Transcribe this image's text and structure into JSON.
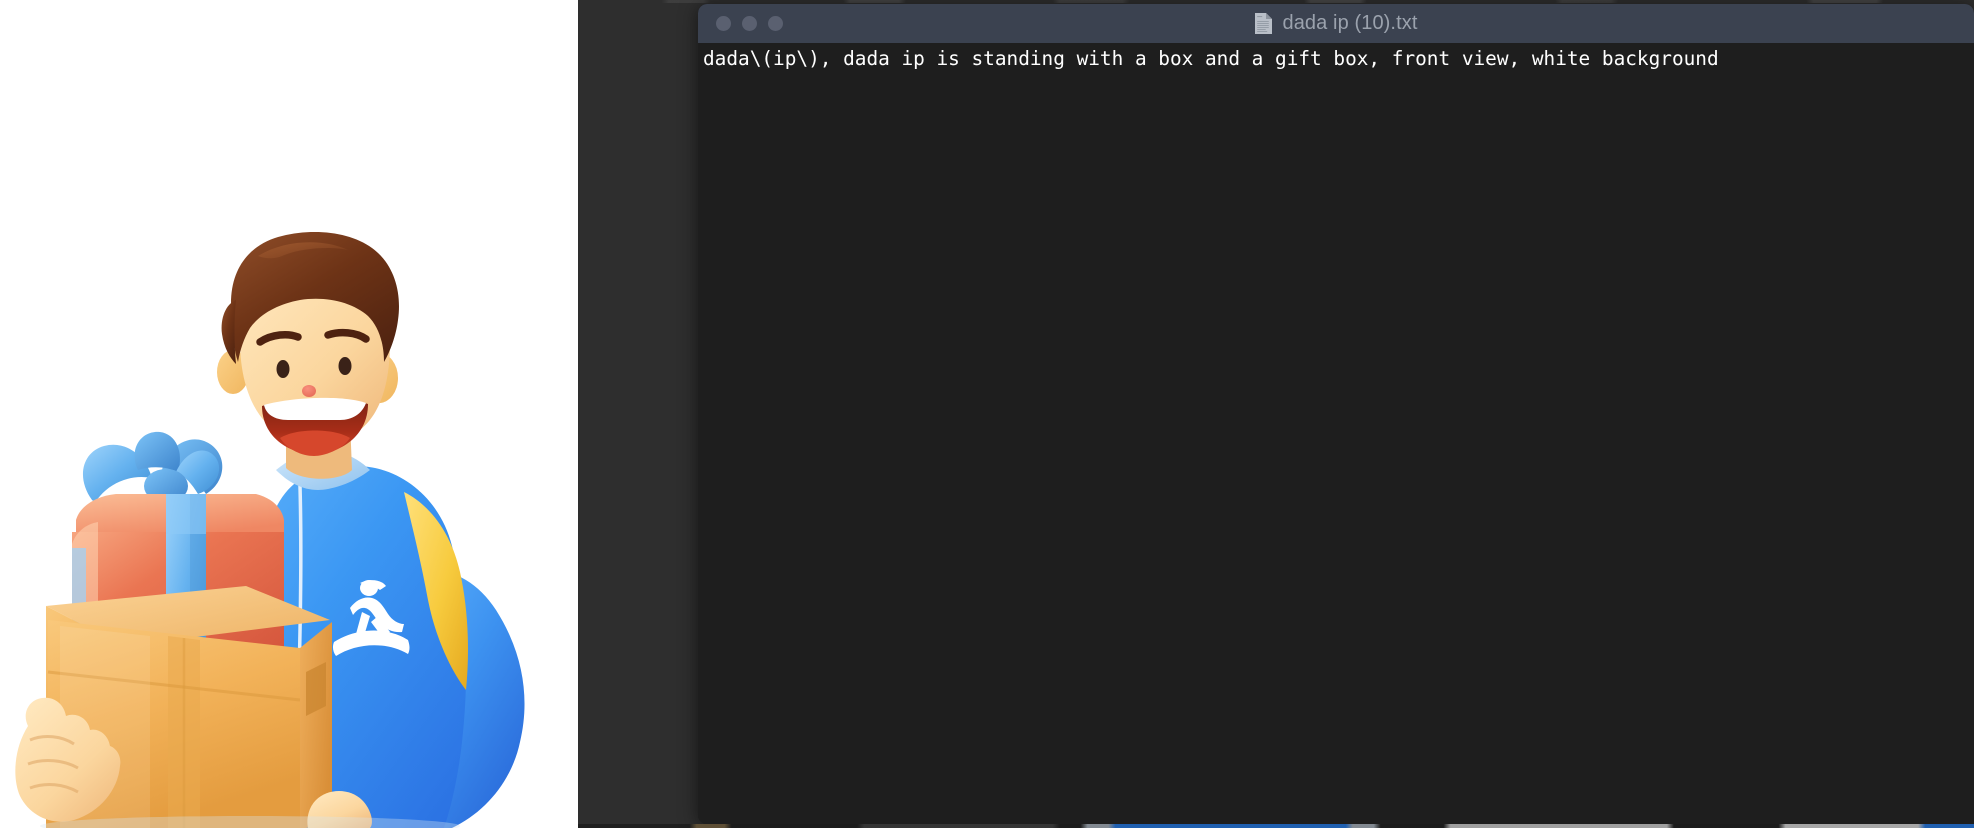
{
  "window": {
    "title": "dada ip (10).txt",
    "file_icon": "document-icon",
    "traffic_lights": [
      {
        "name": "close-button",
        "color": "#5a6070"
      },
      {
        "name": "minimize-button",
        "color": "#5a6070"
      },
      {
        "name": "maximize-button",
        "color": "#5a6070"
      }
    ],
    "title_bar_color": "#3b4250",
    "content_bg_color": "#1e1e1e",
    "title_text_color": "#9ba2ad"
  },
  "document": {
    "line_1": "dada\\(ip\\), dada ip is standing with a box and a gift box, front view, white background",
    "text_color": "#ffffff"
  },
  "image_panel": {
    "alt": "3D illustration of a smiling delivery courier holding a cardboard box and a red gift box with a blue ribbon, front view, white background",
    "background_color": "#ffffff",
    "subject": "delivery-courier-character",
    "colors": {
      "uniform_blue": "#3b97f3",
      "uniform_blue_dark": "#2f6fe0",
      "uniform_yellow": "#f5c93c",
      "skin": "#fad7a0",
      "skin_shadow": "#f0b97b",
      "hair_brown": "#6b3117",
      "hair_brown_light": "#8a4423",
      "gift_red": "#e2614a",
      "gift_red_light": "#ef8f6d",
      "ribbon_blue": "#62b3ef",
      "ribbon_blue_dark": "#4a90d9",
      "carton_orange": "#f3b35c",
      "carton_orange_dark": "#e09a42",
      "carton_tape": "#e8a74f",
      "mouth_red": "#cf3a22",
      "mouth_dark": "#6e2012",
      "teeth_white": "#ffffff",
      "logo_white": "#ffffff"
    }
  },
  "desktop": {
    "background_color": "#2e2e2e"
  }
}
